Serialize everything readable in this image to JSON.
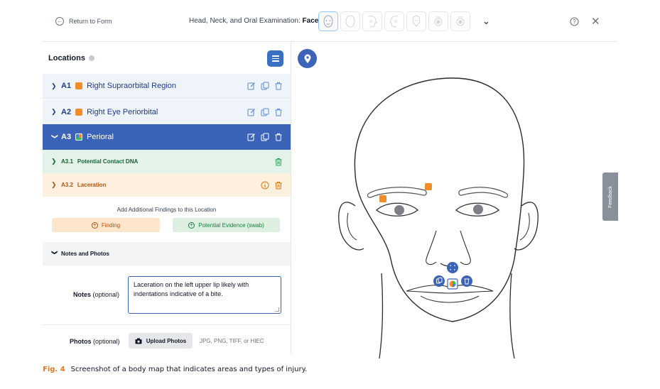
{
  "topbar": {
    "return_label": "Return to Form",
    "exam_title_prefix": "Head, Neck, and Oral Examination: ",
    "exam_title_view": "Face",
    "view_thumbnails": [
      "face-front",
      "head-back",
      "head-right",
      "head-left",
      "head-top",
      "mouth-upper",
      "mouth-lower"
    ]
  },
  "locations": {
    "heading": "Locations",
    "items": [
      {
        "code": "A1",
        "name": "Right Supraorbital Region",
        "swatch": "#f28c28"
      },
      {
        "code": "A2",
        "name": "Right Eye Periorbital",
        "swatch": "#f28c28"
      },
      {
        "code": "A3",
        "name": "Perioral",
        "swatch": "multicolor"
      }
    ],
    "findings": [
      {
        "code": "A3.1",
        "name": "Potential Contact DNA"
      },
      {
        "code": "A3.2",
        "name": "Laceration"
      }
    ],
    "add_label": "Add Additional Findings to this Location",
    "finding_button": "Finding",
    "evidence_button": "Potential Evidence (swab)"
  },
  "notes": {
    "section_title": "Notes and Photos",
    "notes_label": "Notes",
    "notes_optional": " (optional)",
    "notes_value": "Laceration on the left upper lip likely with indentations indicative of a bite.",
    "photos_label": "Photos",
    "photos_optional": " (optional)",
    "upload_button": "Upload Photos",
    "formats": "JPG, PNG, TIFF, or HIEC"
  },
  "feedback_tab": "Feedback",
  "caption": {
    "fig": "Fig. 4",
    "text": "Screenshot of a body map that indicates areas and types of injury."
  },
  "colors": {
    "primary": "#3b63b8",
    "injury_marker": "#f28c28",
    "finding_green": "#15803d",
    "finding_orange": "#b45309"
  }
}
